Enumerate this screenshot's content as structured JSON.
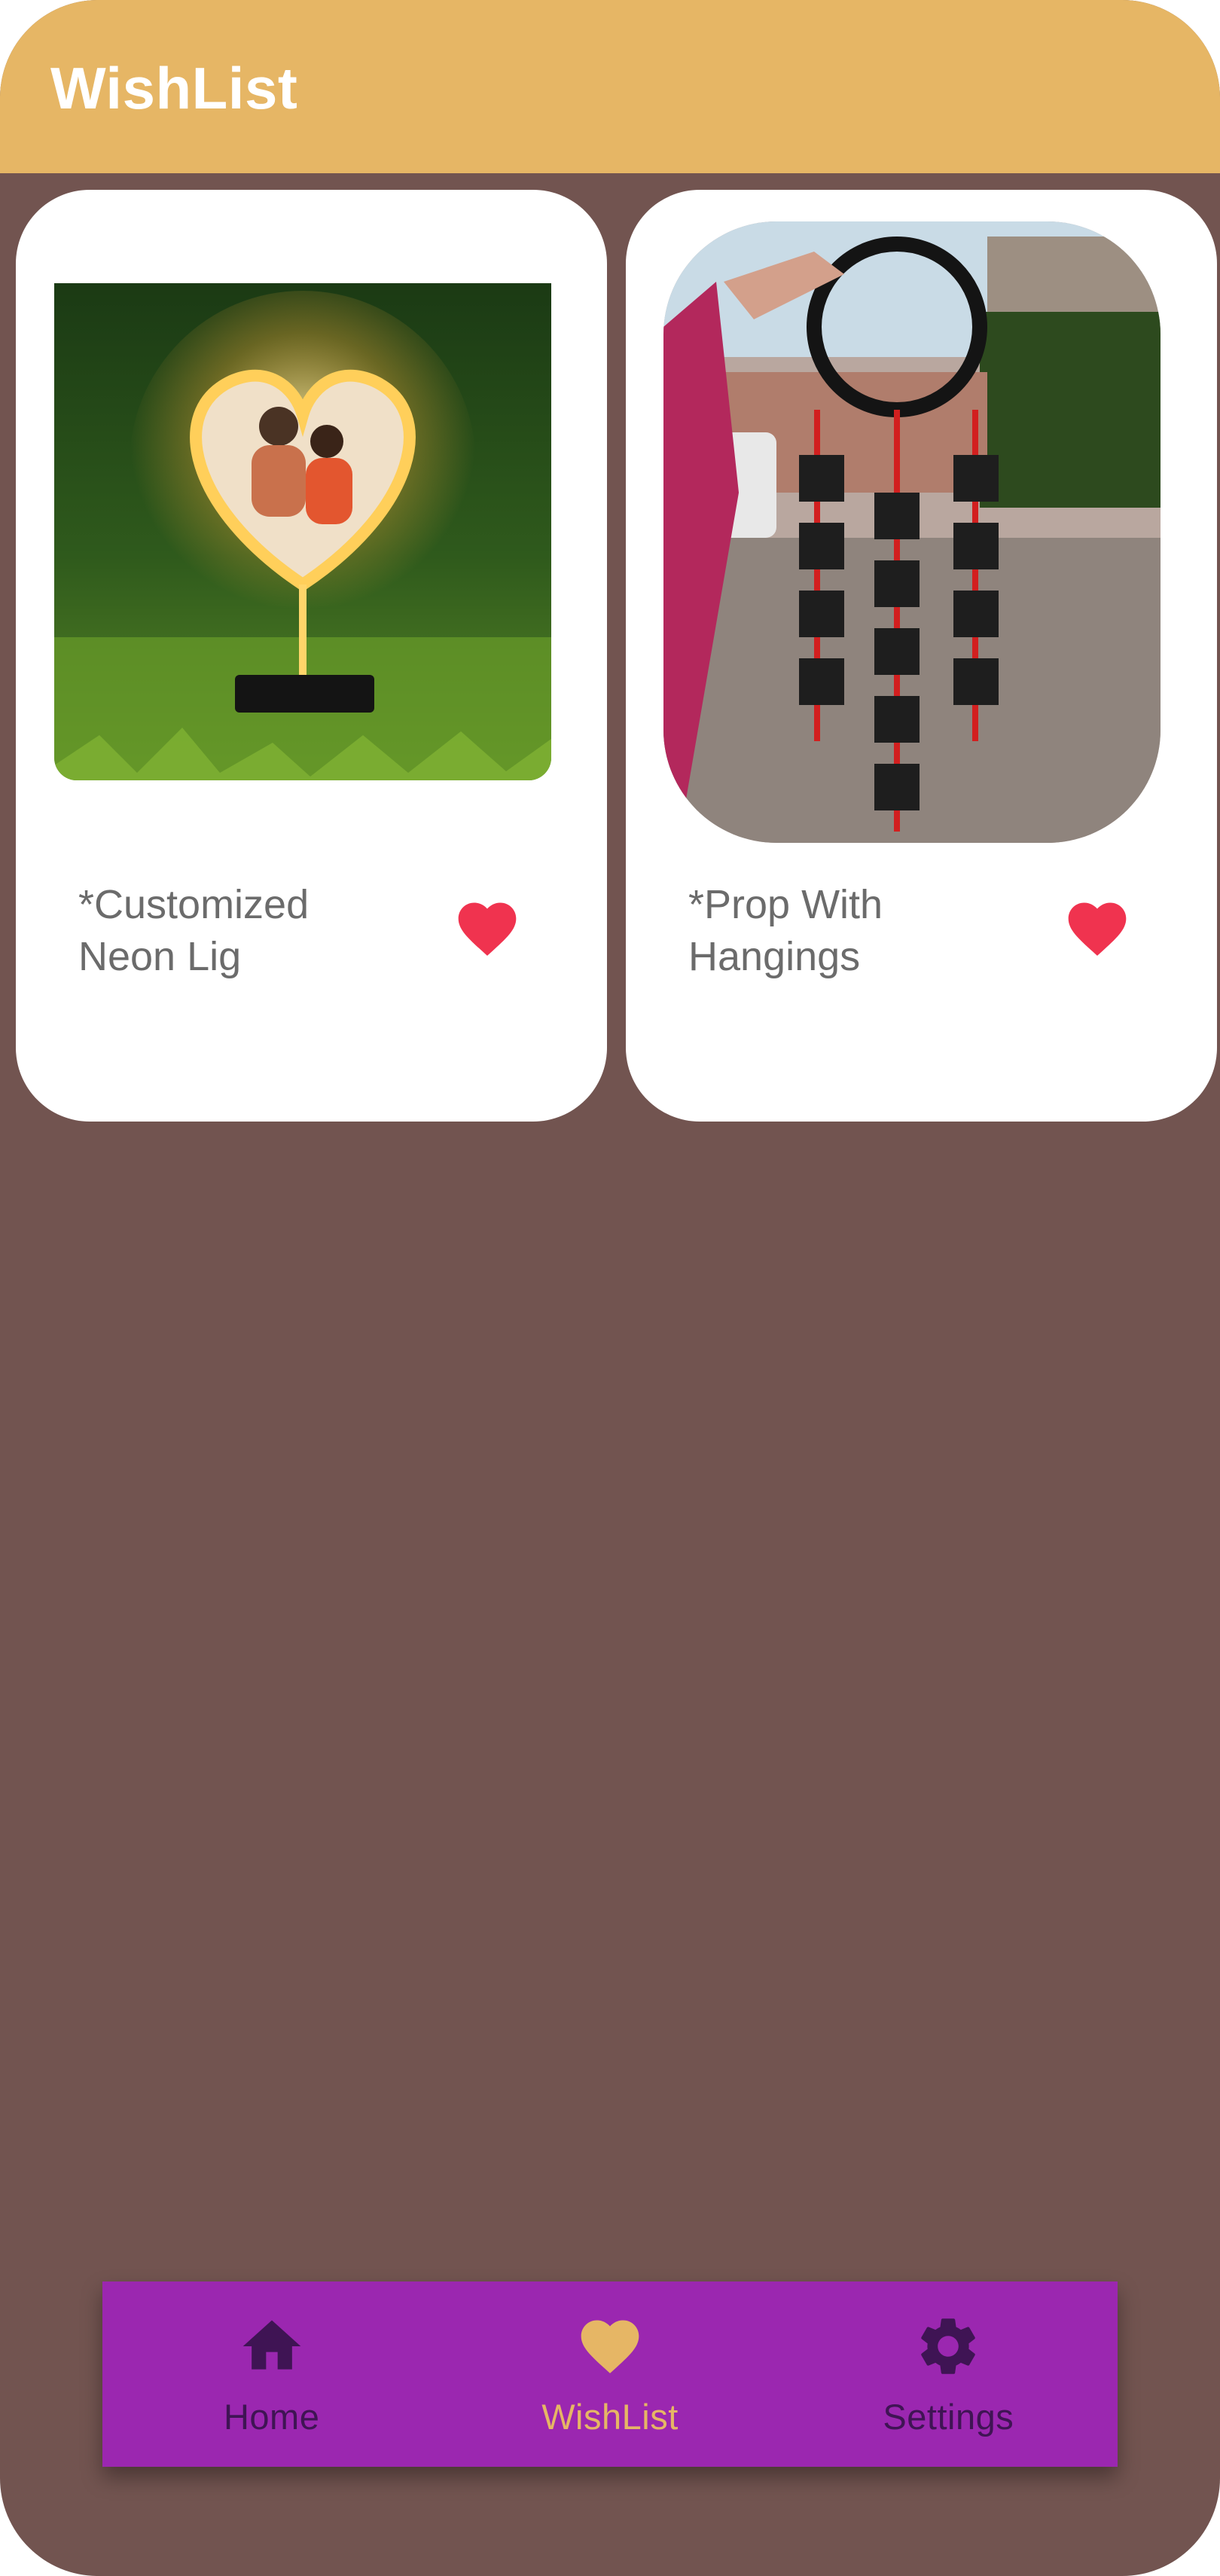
{
  "app_bar": {
    "title": "WishList",
    "color": "#e6b665"
  },
  "background_color": "#725450",
  "wishlist": {
    "items": [
      {
        "name": "*Customized Neon Lig",
        "image": "neon-heart-photo-lamp",
        "favorite_icon": "heart-filled-icon",
        "favorited": true
      },
      {
        "name": "*Prop With Hangings",
        "image": "happy-wedding-anniversary-hanging-prop",
        "favorite_icon": "heart-filled-icon",
        "favorited": true
      }
    ]
  },
  "bottom_nav": {
    "background": "#9b27b0",
    "active_color": "#e6b665",
    "inactive_color": "#3f1454",
    "items": [
      {
        "label": "Home",
        "icon": "home-icon",
        "active": false
      },
      {
        "label": "WishList",
        "icon": "heart-icon",
        "active": true
      },
      {
        "label": "Settings",
        "icon": "gear-icon",
        "active": false
      }
    ]
  }
}
